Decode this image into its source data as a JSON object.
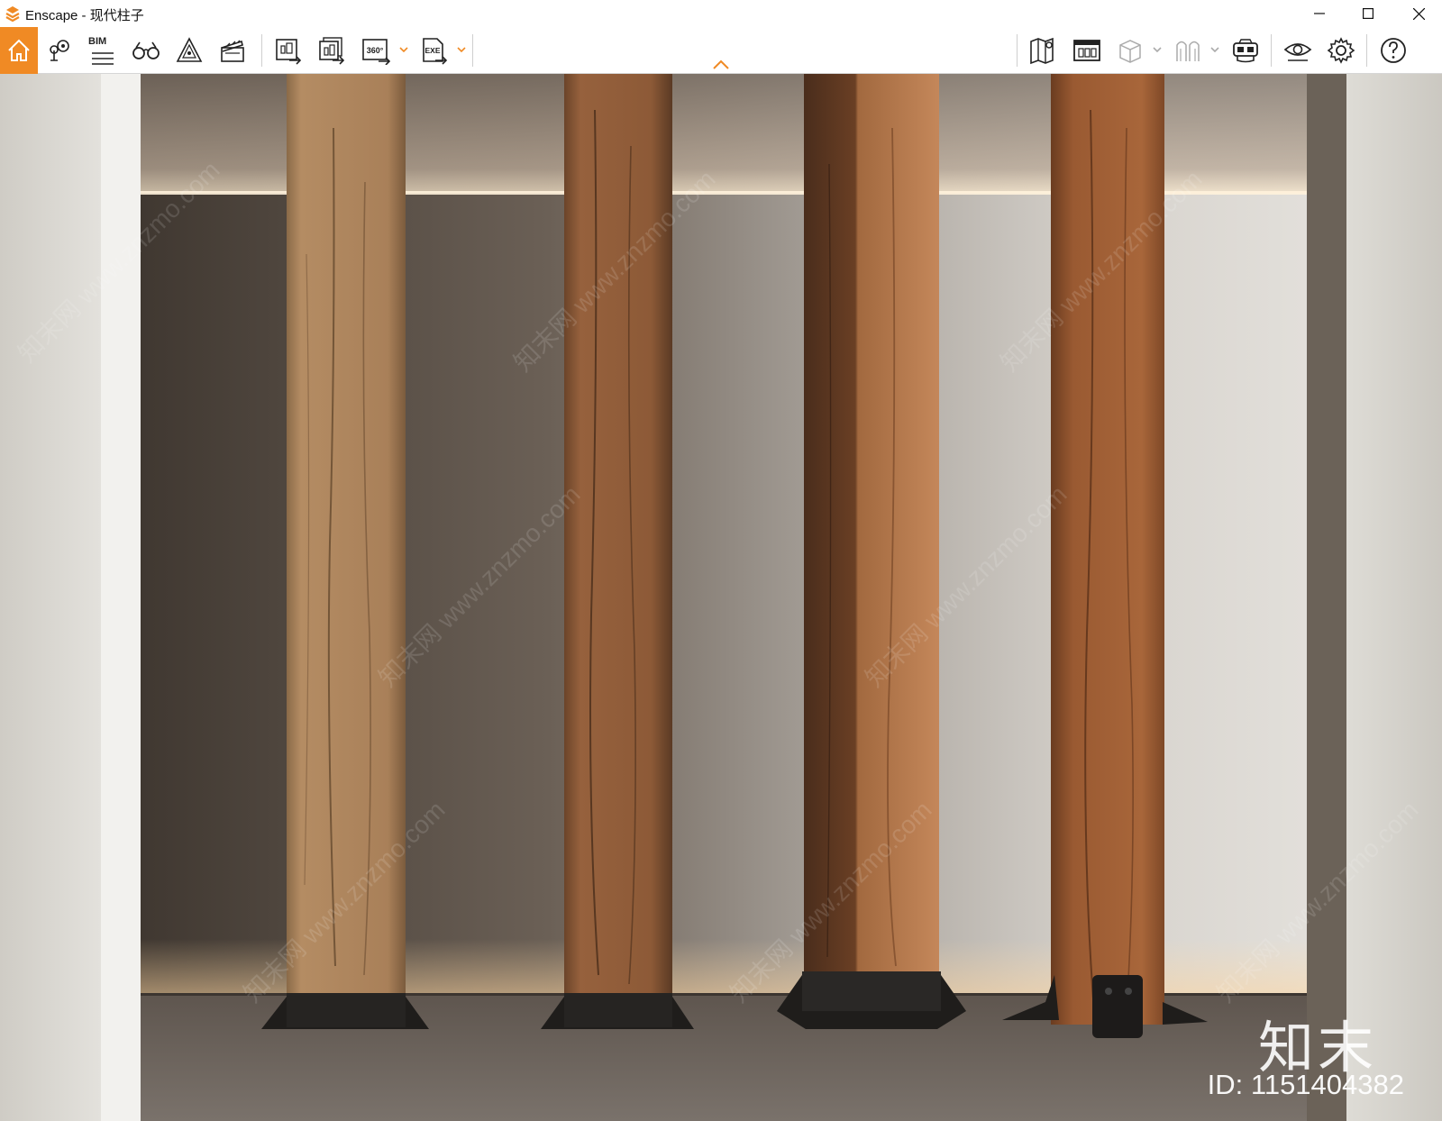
{
  "window": {
    "app_name": "Enscape",
    "title": "Enscape - 现代柱子",
    "controls": [
      "minimize",
      "maximize",
      "close"
    ]
  },
  "toolbar": {
    "left_icons": [
      {
        "name": "home-icon",
        "active": true
      },
      {
        "name": "map-pin-icon"
      },
      {
        "name": "bim-icon",
        "label": "BIM"
      },
      {
        "name": "binoculars-icon"
      },
      {
        "name": "warning-triangle-icon"
      },
      {
        "name": "clapperboard-icon"
      },
      {
        "name": "render-screenshot-icon"
      },
      {
        "name": "batch-render-icon"
      },
      {
        "name": "panorama-360-icon",
        "label": "360°"
      },
      {
        "name": "export-exe-icon",
        "label": "EXE"
      }
    ],
    "right_icons": [
      {
        "name": "map-icon"
      },
      {
        "name": "asset-library-icon"
      },
      {
        "name": "cube-view-icon"
      },
      {
        "name": "material-editor-icon"
      },
      {
        "name": "vr-headset-icon"
      },
      {
        "name": "visual-settings-eye-icon"
      },
      {
        "name": "settings-gear-icon"
      },
      {
        "name": "help-icon"
      }
    ],
    "accent_color": "#f08a24"
  },
  "viewport": {
    "scene": "four wooden columns on black steel base plates in front of a backlit wall niche",
    "watermark_brand": "知末",
    "watermark_id": "ID: 1151404382",
    "watermark_url": "知末网 www.znzmo.com"
  }
}
